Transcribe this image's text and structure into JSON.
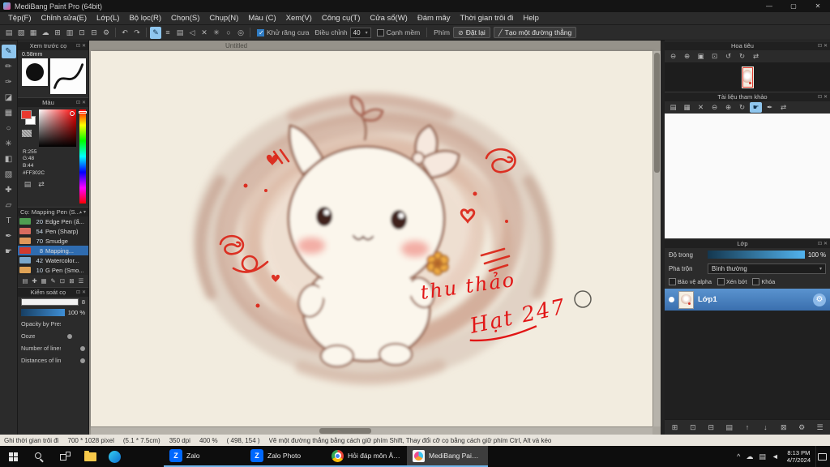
{
  "ui": {
    "caret_down": "▾",
    "caret_up": "▴",
    "collapse_icon": "⊡",
    "close_icon": "✕"
  },
  "window": {
    "title": "MediBang Paint Pro (64bit)",
    "minimize": "—",
    "maximize": "▢",
    "close": "✕"
  },
  "menubar": {
    "items": [
      {
        "label": "Tệp(F)"
      },
      {
        "label": "Chỉnh sửa(E)"
      },
      {
        "label": "Lớp(L)"
      },
      {
        "label": "Bộ lọc(R)"
      },
      {
        "label": "Chọn(S)"
      },
      {
        "label": "Chụp(N)"
      },
      {
        "label": "Màu (C)"
      },
      {
        "label": "Xem(V)"
      },
      {
        "label": "Công cụ(T)"
      },
      {
        "label": "Cửa sổ(W)"
      },
      {
        "label": "Đám mây"
      },
      {
        "label": "Thời gian trôi đi"
      },
      {
        "label": "Help"
      }
    ]
  },
  "toolbar": {
    "file_icons": [
      {
        "name": "new-canvas-icon",
        "glyph": "▤"
      },
      {
        "name": "open-file-icon",
        "glyph": "▧"
      },
      {
        "name": "save-icon",
        "glyph": "▦"
      },
      {
        "name": "cloud-save-icon",
        "glyph": "☁"
      },
      {
        "name": "export-icon",
        "glyph": "⊞"
      },
      {
        "name": "print-icon",
        "glyph": "▥"
      },
      {
        "name": "copy-icon",
        "glyph": "⊡"
      },
      {
        "name": "paste-icon",
        "glyph": "⊟"
      },
      {
        "name": "settings-icon",
        "glyph": "⚙"
      }
    ],
    "history_icons": [
      {
        "name": "undo-button",
        "glyph": "↶"
      },
      {
        "name": "redo-button",
        "glyph": "↷"
      }
    ],
    "draw_icons": [
      {
        "name": "freehand-tool-icon",
        "glyph": "✎",
        "selected": true
      },
      {
        "name": "parallel-lines-icon",
        "glyph": "≡"
      },
      {
        "name": "grid-lines-icon",
        "glyph": "▤"
      },
      {
        "name": "perspective-icon",
        "glyph": "◁"
      },
      {
        "name": "cross-lines-icon",
        "glyph": "✕"
      },
      {
        "name": "radial-lines-icon",
        "glyph": "✳"
      },
      {
        "name": "ellipse-guide-icon",
        "glyph": "○"
      },
      {
        "name": "concentric-guide-icon",
        "glyph": "◎"
      }
    ],
    "antialias": {
      "label": "Khử răng cưa",
      "checked": true
    },
    "adjust": {
      "label": "Điều chỉnh",
      "value": "40"
    },
    "soft_edge": {
      "label": "Cạnh mềm",
      "checked": false
    },
    "key_label": "Phím",
    "reset_button": {
      "icon": "⊘",
      "label": "Đặt lại"
    },
    "line_button": {
      "icon": "╱",
      "label": "Tạo một đường thẳng"
    }
  },
  "tools": {
    "items": [
      {
        "name": "pen-tool",
        "glyph": "✎",
        "selected": true
      },
      {
        "name": "pencil-tool",
        "glyph": "✏"
      },
      {
        "name": "airbrush-tool",
        "glyph": "✑"
      },
      {
        "name": "eraser-tool",
        "glyph": "◪"
      },
      {
        "name": "select-tool",
        "glyph": "▦"
      },
      {
        "name": "lasso-tool",
        "glyph": "○"
      },
      {
        "name": "magic-wand-tool",
        "glyph": "✳"
      },
      {
        "name": "bucket-tool",
        "glyph": "◧"
      },
      {
        "name": "gradient-tool",
        "glyph": "▧"
      },
      {
        "name": "move-tool",
        "glyph": "✚"
      },
      {
        "name": "transform-tool",
        "glyph": "▱"
      },
      {
        "name": "text-tool",
        "glyph": "T"
      },
      {
        "name": "eyedropper-tool",
        "glyph": "✒"
      },
      {
        "name": "hand-tool",
        "glyph": "☛"
      }
    ]
  },
  "brush_preview": {
    "title": "Xem trước cọ",
    "size": "0.58mm"
  },
  "color_panel": {
    "title": "Màu",
    "r": "R:255",
    "g": "G:48",
    "b": "B:44",
    "hex": "#FF302C",
    "buttons": [
      {
        "name": "color-sliders-icon",
        "glyph": "▤"
      },
      {
        "name": "swap-colors-icon",
        "glyph": "⇄"
      }
    ]
  },
  "brush_panel": {
    "title": "Cọ: Mapping Pen (S...",
    "items": [
      {
        "name": "brush-item",
        "size": "20",
        "label": "Edge Pen (ẩ...",
        "color": "#4f9e52"
      },
      {
        "name": "brush-item",
        "size": "54",
        "label": "Pen (Sharp)",
        "color": "#d96c5f"
      },
      {
        "name": "brush-item",
        "size": "70",
        "label": "Smudge",
        "color": "#e0985a"
      },
      {
        "name": "brush-item",
        "size": "8",
        "label": "Mapping...",
        "color": "#d23b2e",
        "selected": true
      },
      {
        "name": "brush-item",
        "size": "42",
        "label": "Watercolor...",
        "color": "#7aa8cc"
      },
      {
        "name": "brush-item",
        "size": "10",
        "label": "G Pen (Smo...",
        "color": "#e0a356"
      }
    ],
    "tools": [
      {
        "name": "brush-folder-icon",
        "glyph": "▤"
      },
      {
        "name": "brush-add-icon",
        "glyph": "✚"
      },
      {
        "name": "brush-save-icon",
        "glyph": "▦"
      },
      {
        "name": "brush-edit-icon",
        "glyph": "✎"
      },
      {
        "name": "brush-duplicate-icon",
        "glyph": "⊡"
      },
      {
        "name": "brush-delete-icon",
        "glyph": "⊠"
      },
      {
        "name": "brush-menu-icon",
        "glyph": "☰"
      }
    ]
  },
  "brush_control": {
    "title": "Kiểm soát cọ",
    "size_value": "8",
    "opacity_value": "100 %",
    "items": [
      {
        "name": "control-opacity-by-pressure",
        "label": "Opacity by Pressure",
        "knob": "none"
      },
      {
        "name": "control-ooze",
        "label": "Ooze",
        "knob": "mid"
      },
      {
        "name": "control-number-of-lines",
        "label": "Number of lines",
        "knob": "right"
      },
      {
        "name": "control-distances-of-lines",
        "label": "Distances of lines",
        "knob": "right"
      }
    ]
  },
  "canvas": {
    "tab": "Untitled",
    "signature_line1": "thu thảo",
    "signature_line2": "Hạt 247"
  },
  "navigator": {
    "title": "Hoa tiêu",
    "tools": [
      {
        "name": "zoom-out-icon",
        "glyph": "⊖"
      },
      {
        "name": "zoom-in-icon",
        "glyph": "⊕"
      },
      {
        "name": "zoom-fit-icon",
        "glyph": "▣"
      },
      {
        "name": "zoom-100-icon",
        "glyph": "⊡"
      },
      {
        "name": "rotate-left-icon",
        "glyph": "↺"
      },
      {
        "name": "rotate-right-icon",
        "glyph": "↻"
      },
      {
        "name": "flip-icon",
        "glyph": "⇄"
      }
    ]
  },
  "reference": {
    "title": "Tài liệu tham khảo",
    "tools": [
      {
        "name": "ref-open-icon",
        "glyph": "▤"
      },
      {
        "name": "ref-save-icon",
        "glyph": "▦"
      },
      {
        "name": "ref-clear-icon",
        "glyph": "✕"
      },
      {
        "name": "ref-zoom-out-icon",
        "glyph": "⊖"
      },
      {
        "name": "ref-zoom-in-icon",
        "glyph": "⊕"
      },
      {
        "name": "ref-rotate-icon",
        "glyph": "↻"
      },
      {
        "name": "ref-hand-icon",
        "glyph": "☛",
        "selected": true
      },
      {
        "name": "ref-eyedropper-icon",
        "glyph": "✒"
      },
      {
        "name": "ref-flip-icon",
        "glyph": "⇄"
      }
    ]
  },
  "layers": {
    "title": "Lớp",
    "opacity_label": "Độ trong",
    "opacity_value": "100 %",
    "blend_label": "Pha trộn",
    "blend_value": "Bình thường",
    "gear_icon": "⚙",
    "options": [
      {
        "name": "alpha-protect-option",
        "label": "Bảo vệ alpha"
      },
      {
        "name": "clipping-option",
        "label": "Xén bớt"
      },
      {
        "name": "lock-option",
        "label": "Khóa"
      }
    ],
    "items": [
      {
        "name": "layer-row-lop1",
        "label": "Lớp1",
        "selected": true
      }
    ],
    "tools": [
      {
        "name": "add-layer-icon",
        "glyph": "⊞"
      },
      {
        "name": "duplicate-layer-icon",
        "glyph": "⊡"
      },
      {
        "name": "merge-layer-icon",
        "glyph": "⊟"
      },
      {
        "name": "layer-folder-icon",
        "glyph": "▤"
      },
      {
        "name": "layer-up-icon",
        "glyph": "↑"
      },
      {
        "name": "layer-down-icon",
        "glyph": "↓"
      },
      {
        "name": "delete-layer-icon",
        "glyph": "⊠"
      },
      {
        "name": "layer-settings-icon",
        "glyph": "⚙"
      },
      {
        "name": "layer-menu-icon",
        "glyph": "☰"
      }
    ]
  },
  "statusbar": {
    "record": "Ghi thời gian trôi đi",
    "size": "700 * 1028 pixel",
    "physical": "(5.1 * 7.5cm)",
    "dpi": "350 dpi",
    "zoom": "400 %",
    "cursor": "( 498, 154 )",
    "hint": "Vẽ một đường thẳng bằng cách giữ phím Shift, Thay đổi cỡ cọ bằng cách giữ phím Ctrl, Alt và kéo"
  },
  "taskbar": {
    "pinned": [
      {
        "name": "file-explorer-icon",
        "icon": "folder"
      },
      {
        "name": "browser-icon",
        "icon": "edge"
      }
    ],
    "apps": [
      {
        "name": "taskbar-app-zalo",
        "label": "Zalo",
        "icon": "zalo"
      },
      {
        "name": "taskbar-app-zalo-photo",
        "label": "Zalo Photo",
        "icon": "zalo"
      },
      {
        "name": "taskbar-app-chrome",
        "label": "Hỏi đáp môn Âm n...",
        "icon": "chrome"
      },
      {
        "name": "taskbar-app-medibang",
        "label": "MediBang Paint Pro...",
        "icon": "medibang",
        "active": true
      }
    ],
    "tray": [
      {
        "name": "tray-chevron-icon",
        "glyph": "^"
      },
      {
        "name": "tray-cloud-icon",
        "glyph": "☁"
      },
      {
        "name": "tray-network-icon",
        "glyph": "▤"
      },
      {
        "name": "tray-volume-icon",
        "glyph": "◄"
      }
    ],
    "time": "8:13 PM",
    "date": "4/7/2024"
  }
}
